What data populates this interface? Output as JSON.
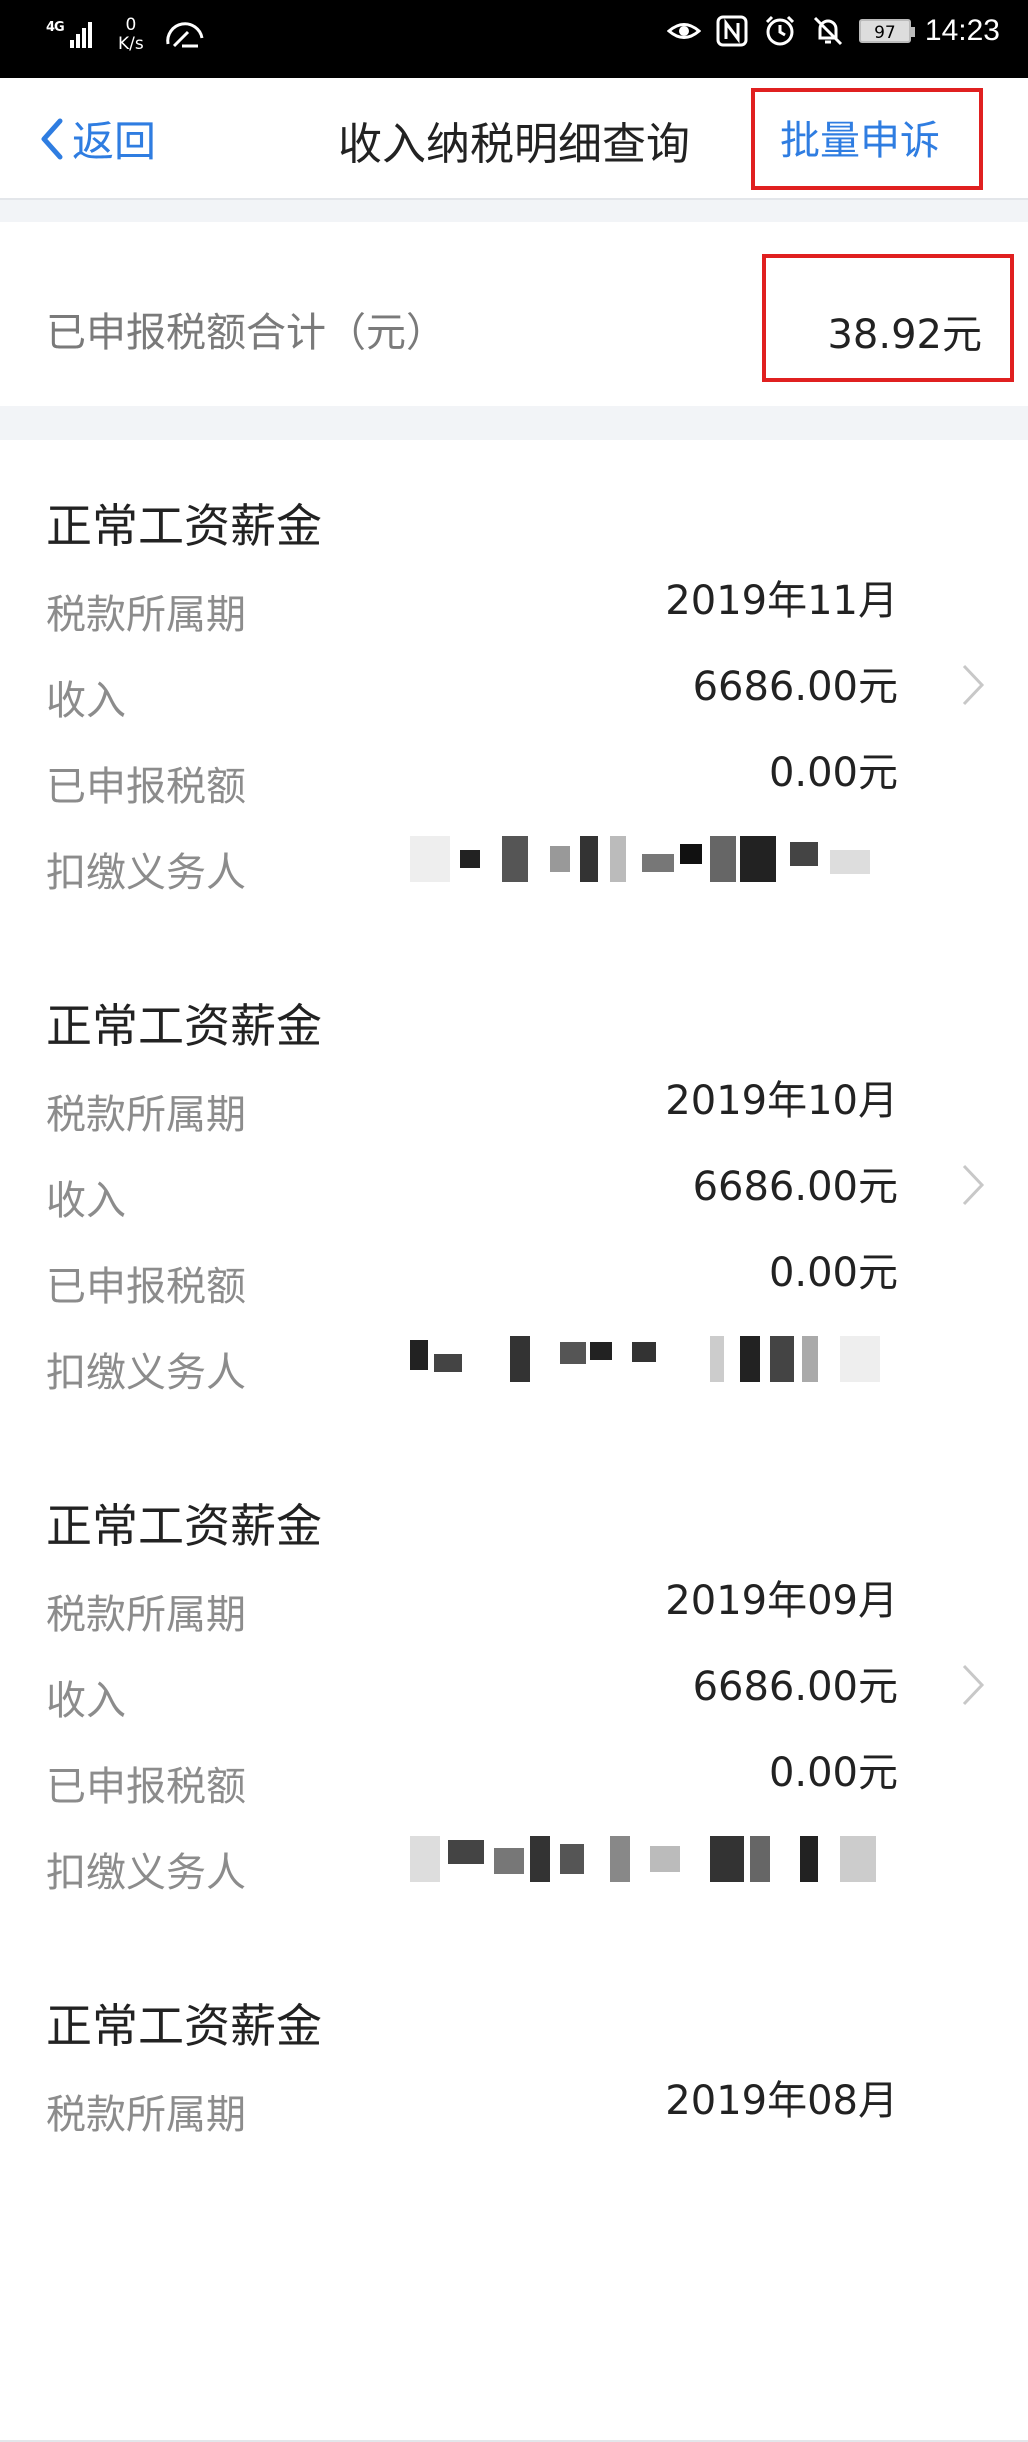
{
  "status_bar": {
    "network": "4G",
    "speed_value": "0",
    "speed_unit": "K/s",
    "battery": "97",
    "time": "14:23"
  },
  "nav": {
    "back_label": "返回",
    "title": "收入纳税明细查询",
    "batch_appeal": "批量申诉"
  },
  "summary": {
    "label": "已申报税额合计（元）",
    "value": "38.92元"
  },
  "field_labels": {
    "period": "税款所属期",
    "income": "收入",
    "tax": "已申报税额",
    "withholder": "扣缴义务人"
  },
  "records": [
    {
      "title": "正常工资薪金",
      "period": "2019年11月",
      "income": "6686.00元",
      "tax": "0.00元"
    },
    {
      "title": "正常工资薪金",
      "period": "2019年10月",
      "income": "6686.00元",
      "tax": "0.00元"
    },
    {
      "title": "正常工资薪金",
      "period": "2019年09月",
      "income": "6686.00元",
      "tax": "0.00元"
    },
    {
      "title": "正常工资薪金",
      "period": "2019年08月"
    }
  ],
  "colors": {
    "accent": "#2f7de1",
    "highlight_box": "#e02020"
  }
}
